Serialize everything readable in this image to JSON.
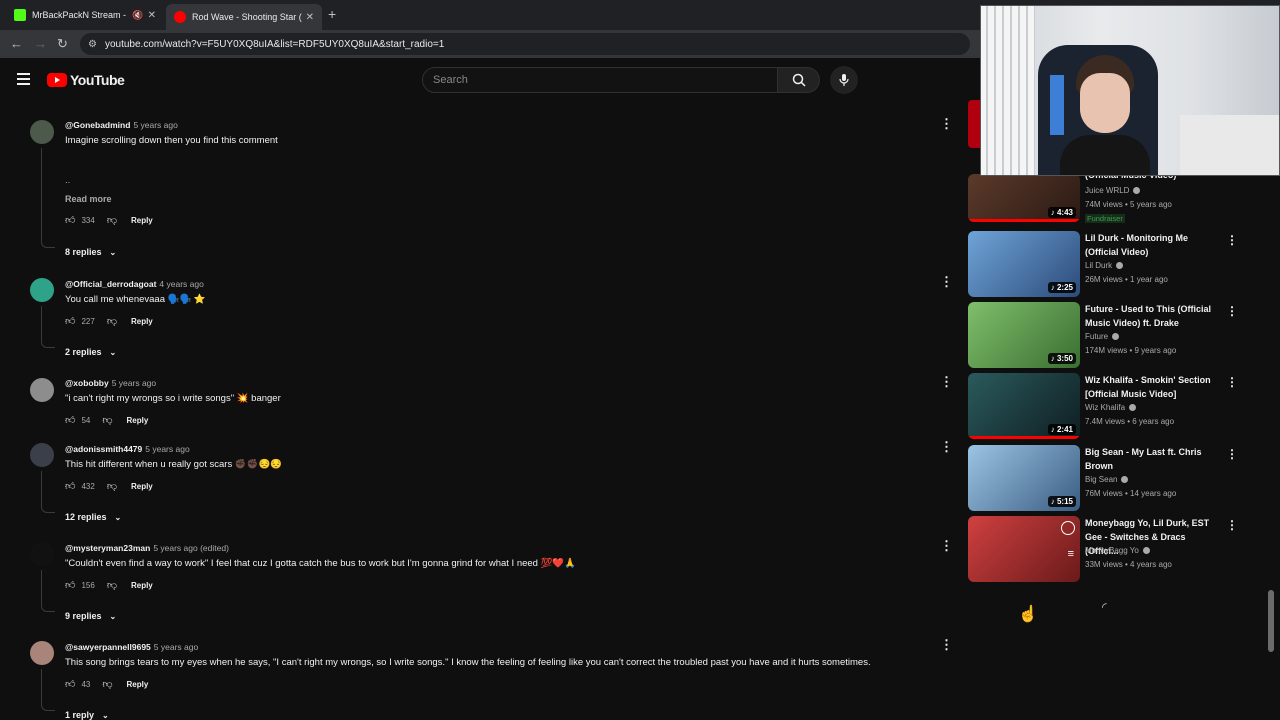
{
  "browser": {
    "tabs": [
      {
        "title": "MrBackPackN Stream - Wa",
        "color": "#53fc18"
      },
      {
        "title": "Rod Wave - Shooting Star (Offi",
        "color": "#ff0000"
      }
    ],
    "url": "youtube.com/watch?v=F5UY0XQ8uIA&list=RDF5UY0XQ8uIA&start_radio=1"
  },
  "header": {
    "logo_text": "YouTube",
    "search_placeholder": "Search"
  },
  "comments": [
    {
      "handle": "@Gonebadmind",
      "age": "5 years ago",
      "text": "Imagine scrolling down then you find this comment",
      "extra": "..",
      "read_more": "Read more",
      "likes": "334",
      "reply": "Reply",
      "replies": "8 replies",
      "avatar": "#4b5a4a"
    },
    {
      "handle": "@Official_derrodagoat",
      "age": "4 years ago",
      "text": "You call me whenevaаa 🗣️🗣️ ⭐",
      "likes": "227",
      "reply": "Reply",
      "replies": "2 replies",
      "avatar": "#2fa38a"
    },
    {
      "handle": "@xobobby",
      "age": "5 years ago",
      "text": "\"i can't right my wrongs so i write songs\" 💥 banger",
      "likes": "54",
      "reply": "Reply",
      "replies": "",
      "avatar": "#8d8d8d"
    },
    {
      "handle": "@adonissmith4479",
      "age": "5 years ago",
      "text": "This hit different when u really got scars ✊🏿✊🏿😔😔",
      "likes": "432",
      "reply": "Reply",
      "replies": "12 replies",
      "avatar": "#3a3f4a"
    },
    {
      "handle": "@mysteryman23man",
      "age": "5 years ago (edited)",
      "text": "\"Couldn't even find a way to work\" I feel that cuz I gotta catch the bus to work but I'm gonna grind for what I need 💯❤️🙏",
      "likes": "156",
      "reply": "Reply",
      "replies": "9 replies",
      "avatar": "#111111"
    },
    {
      "handle": "@sawyerpannell9695",
      "age": "5 years ago",
      "text": "This song brings tears to my eyes when he says, \"I can't right my wrongs, so I write songs.\" I know the feeling of feeling like you can't correct the troubled past you have and it hurts sometimes.",
      "likes": "43",
      "reply": "Reply",
      "replies": "1 reply",
      "avatar": "#a8847a"
    }
  ],
  "sidebar": [
    {
      "title": "(Official Music Video)",
      "channel": "Juice WRLD",
      "meta": "74M views • 5 years ago",
      "badge": "Fundraiser",
      "duration": "4:43",
      "thumb": "#4a2a20"
    },
    {
      "title": "Lil Durk - Monitoring Me (Official Video)",
      "channel": "Lil Durk",
      "meta": "26M views • 1 year ago",
      "duration": "2:25",
      "thumb": "#3b6fb0"
    },
    {
      "title": "Future - Used to This (Official Music Video) ft. Drake",
      "channel": "Future",
      "meta": "174M views • 9 years ago",
      "duration": "3:50",
      "thumb": "#3f8a3f"
    },
    {
      "title": "Wiz Khalifa - Smokin' Section [Official Music Video]",
      "channel": "Wiz Khalifa",
      "meta": "7.4M views • 6 years ago",
      "duration": "2:41",
      "thumb": "#1c3a3c"
    },
    {
      "title": "Big Sean - My Last ft. Chris Brown",
      "channel": "Big Sean",
      "meta": "76M views • 14 years ago",
      "duration": "5:15",
      "thumb": "#5f8fb8"
    },
    {
      "title": "Moneybagg Yo, Lil Durk, EST Gee - Switches & Dracs (Offici...",
      "channel": "MoneyBagg Yo",
      "meta": "33M views • 4 years ago",
      "duration": "",
      "thumb": "#b83030"
    }
  ]
}
